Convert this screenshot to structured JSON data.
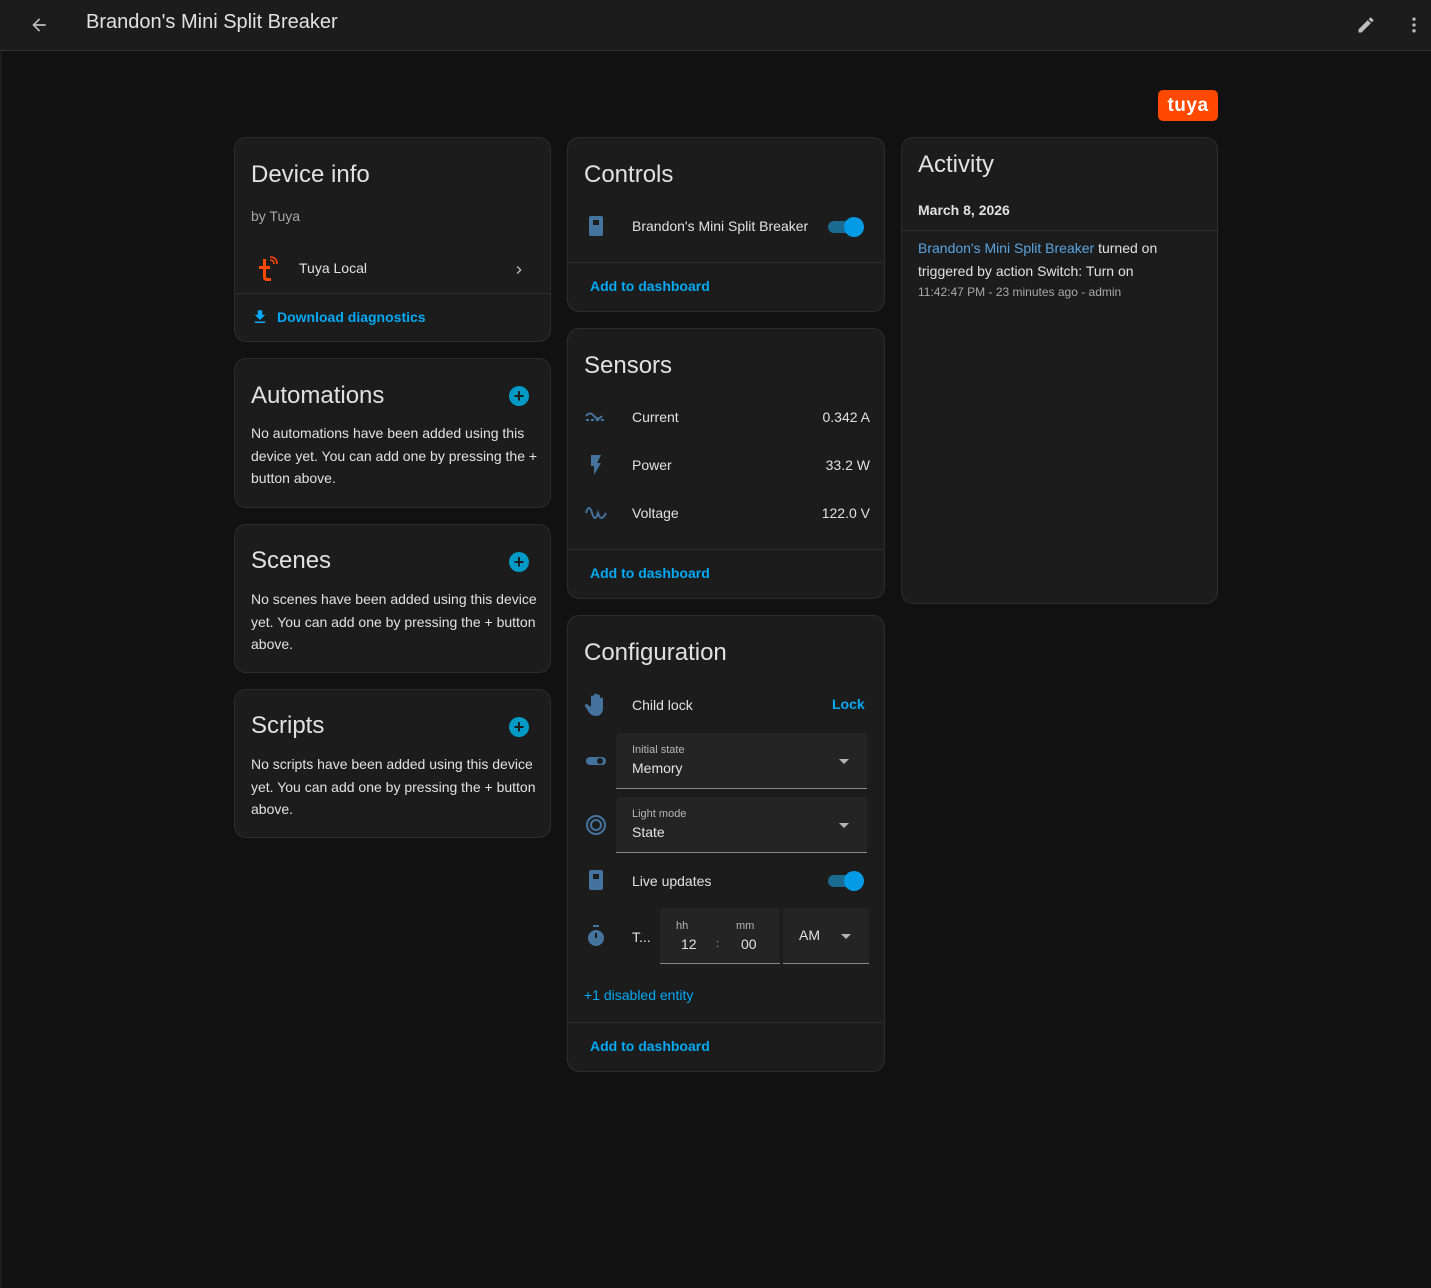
{
  "header": {
    "title": "Brandon's Mini Split Breaker"
  },
  "brand": {
    "logo_text": "tuya",
    "color": "#ff4800"
  },
  "device_info": {
    "title": "Device info",
    "manufacturer": "by Tuya",
    "integration": "Tuya Local",
    "download_label": "Download diagnostics"
  },
  "automations": {
    "title": "Automations",
    "empty_text": "No automations have been added using this device yet. You can add one by pressing the + button above."
  },
  "scenes": {
    "title": "Scenes",
    "empty_text": "No scenes have been added using this device yet. You can add one by pressing the + button above."
  },
  "scripts": {
    "title": "Scripts",
    "empty_text": "No scripts have been added using this device yet. You can add one by pressing the + button above."
  },
  "controls": {
    "title": "Controls",
    "switch_label": "Brandon's Mini Split Breaker",
    "switch_on": true,
    "add_label": "Add to dashboard"
  },
  "sensors": {
    "title": "Sensors",
    "items": [
      {
        "label": "Current",
        "value": "0.342 A",
        "icon": "current-ac-icon"
      },
      {
        "label": "Power",
        "value": "33.2 W",
        "icon": "flash-icon"
      },
      {
        "label": "Voltage",
        "value": "122.0 V",
        "icon": "sine-wave-icon"
      }
    ],
    "add_label": "Add to dashboard"
  },
  "configuration": {
    "title": "Configuration",
    "child_lock_label": "Child lock",
    "child_lock_action": "Lock",
    "initial_state_label": "Initial state",
    "initial_state_value": "Memory",
    "light_mode_label": "Light mode",
    "light_mode_value": "State",
    "live_updates_label": "Live updates",
    "live_updates_on": true,
    "timer_label": "T...",
    "hh_label": "hh",
    "hh_value": "12",
    "mm_label": "mm",
    "mm_value": "00",
    "colon": ":",
    "ampm_value": "AM",
    "disabled_entities": "+1 disabled entity",
    "add_label": "Add to dashboard"
  },
  "activity": {
    "title": "Activity",
    "date": "March 8, 2026",
    "entry_entity": "Brandon's Mini Split Breaker",
    "entry_action": " turned on",
    "entry_trigger": "triggered by action Switch: Turn on",
    "entry_meta": "11:42:47 PM - 23 minutes ago - admin"
  },
  "colors": {
    "background": "#111111",
    "card": "#1c1c1c",
    "accent": "#03a9f4",
    "icon": "#44739e"
  }
}
